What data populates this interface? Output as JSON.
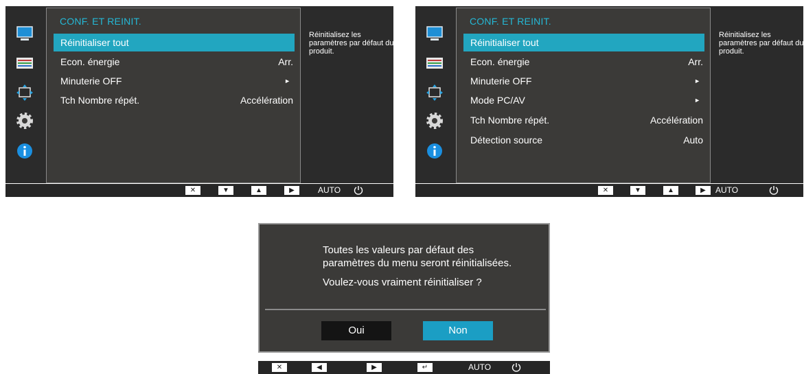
{
  "colors": {
    "accent": "#24b8d6",
    "selected": "#22a6c0",
    "panel": "#3b3a38",
    "frame": "#2b2b2b",
    "dialog_non": "#1b9ec4"
  },
  "screen_left": {
    "menu": {
      "title": "CONF. ET REINIT.",
      "items": [
        {
          "label": "Réinitialiser tout",
          "value": "",
          "arrow": ""
        },
        {
          "label": "Econ. énergie",
          "value": "Arr.",
          "arrow": ""
        },
        {
          "label": "Minuterie OFF",
          "value": "",
          "arrow": "►"
        },
        {
          "label": "Tch Nombre répét.",
          "value": "Accélération",
          "arrow": ""
        }
      ]
    },
    "help": "Réinitialisez les paramètres par défaut du produit.",
    "buttons": {
      "auto": "AUTO"
    }
  },
  "screen_right": {
    "menu": {
      "title": "CONF. ET REINIT.",
      "items": [
        {
          "label": "Réinitialiser tout",
          "value": "",
          "arrow": ""
        },
        {
          "label": "Econ. énergie",
          "value": "Arr.",
          "arrow": ""
        },
        {
          "label": "Minuterie OFF",
          "value": "",
          "arrow": "►"
        },
        {
          "label": "Mode PC/AV",
          "value": "",
          "arrow": "►"
        },
        {
          "label": "Tch Nombre répét.",
          "value": "Accélération",
          "arrow": ""
        },
        {
          "label": "Détection source",
          "value": "Auto",
          "arrow": ""
        }
      ]
    },
    "help": "Réinitialisez les paramètres par défaut du produit.",
    "buttons": {
      "auto": "AUTO"
    }
  },
  "dialog": {
    "line1": "Toutes les valeurs par défaut des",
    "line2": "paramètres du menu seront réinitialisées.",
    "line3": "Voulez-vous vraiment réinitialiser ?",
    "yes": "Oui",
    "no": "Non",
    "buttons": {
      "auto": "AUTO"
    }
  },
  "icons": [
    "picture-icon",
    "color-icon",
    "size-position-icon",
    "setup-reset-icon",
    "information-icon",
    "close-icon",
    "arrow-down-icon",
    "arrow-up-icon",
    "arrow-right-icon",
    "arrow-left-icon",
    "enter-icon",
    "power-icon"
  ]
}
